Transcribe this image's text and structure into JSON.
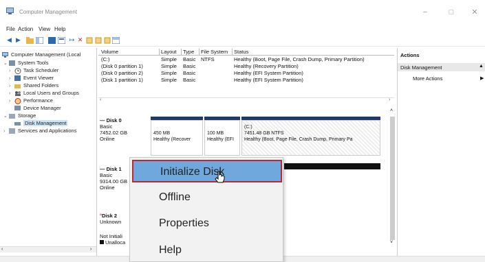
{
  "window": {
    "title": "Computer Management",
    "controls": {
      "minimize": "−",
      "maximize": "□",
      "close": "✕"
    }
  },
  "menu": [
    "File",
    "Action",
    "View",
    "Help"
  ],
  "toolbar": {
    "icons": [
      "back-arrow-icon",
      "forward-arrow-icon",
      "up-folder-icon",
      "show-hide-tree-icon",
      "help-icon",
      "properties-icon",
      "connect-icon",
      "delete-icon",
      "settings-icon",
      "refresh-icon",
      "export-icon",
      "view-icon"
    ]
  },
  "tree": {
    "items": [
      {
        "label": "Computer Management (Local",
        "indent": 0,
        "caret": ""
      },
      {
        "label": "System Tools",
        "indent": 1,
        "caret": "v"
      },
      {
        "label": "Task Scheduler",
        "indent": 2,
        "caret": ">"
      },
      {
        "label": "Event Viewer",
        "indent": 2,
        "caret": ">"
      },
      {
        "label": "Shared Folders",
        "indent": 2,
        "caret": ">"
      },
      {
        "label": "Local Users and Groups",
        "indent": 2,
        "caret": ">"
      },
      {
        "label": "Performance",
        "indent": 2,
        "caret": ">"
      },
      {
        "label": "Device Manager",
        "indent": 2,
        "caret": ""
      },
      {
        "label": "Storage",
        "indent": 1,
        "caret": "v"
      },
      {
        "label": "Disk Management",
        "indent": 2,
        "caret": "",
        "selected": true
      },
      {
        "label": "Services and Applications",
        "indent": 1,
        "caret": ">"
      }
    ]
  },
  "volumes": {
    "columns": [
      "Volume",
      "Layout",
      "Type",
      "File System",
      "Status"
    ],
    "rows": [
      [
        "(C:)",
        "Simple",
        "Basic",
        "NTFS",
        "Healthy (Boot, Page File, Crash Dump, Primary Partition)"
      ],
      [
        "(Disk 0 partition 1)",
        "Simple",
        "Basic",
        "",
        "Healthy (Recovery Partition)"
      ],
      [
        "(Disk 0 partition 2)",
        "Simple",
        "Basic",
        "",
        "Healthy (EFI System Partition)"
      ],
      [
        "(Disk 1 partition 1)",
        "Simple",
        "Basic",
        "",
        "Healthy (EFI System Partition)"
      ]
    ]
  },
  "disks": [
    {
      "name": "Disk 0",
      "type": "Basic",
      "size": "7452.02 GB",
      "status": "Online",
      "partitions": [
        {
          "line1": "450 MB",
          "line2": "Healthy (Recover"
        },
        {
          "line1": "100 MB",
          "line2": "Healthy (EFI"
        },
        {
          "line0": "(C:)",
          "line1": "7451.48 GB NTFS",
          "line2": "Healthy (Boot, Page File, Crash Dump, Primary Pa"
        }
      ]
    },
    {
      "name": "Disk 1",
      "type": "Basic",
      "size": "9314.00 GB",
      "status": "Online"
    },
    {
      "name": "Disk 2",
      "status": "Unknown",
      "init": "Not Initiali",
      "legend": "Unalloca"
    }
  ],
  "actions": {
    "header": "Actions",
    "section": "Disk Management",
    "more": "More Actions"
  },
  "context_menu": {
    "items": [
      "Initialize Disk",
      "Offline",
      "Properties",
      "Help"
    ],
    "highlight_color": "#6fa8dc",
    "border_color": "#c0262d"
  }
}
